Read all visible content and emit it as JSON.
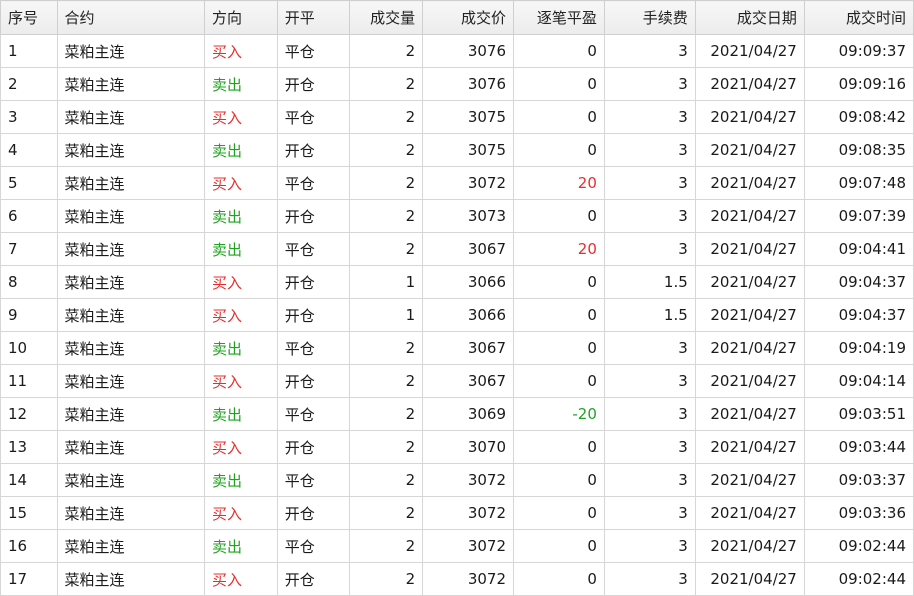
{
  "columns": [
    "序号",
    "合约",
    "方向",
    "开平",
    "成交量",
    "成交价",
    "逐笔平盈",
    "手续费",
    "成交日期",
    "成交时间"
  ],
  "colors": {
    "buy": "#ee2b2b",
    "sell": "#1fa41f"
  },
  "rows": [
    {
      "seq": "1",
      "contract": "菜粕主连",
      "direction": "买入",
      "offset": "平仓",
      "volume": "2",
      "price": "3076",
      "pnl": "0",
      "fee": "3",
      "date": "2021/04/27",
      "time": "09:09:37"
    },
    {
      "seq": "2",
      "contract": "菜粕主连",
      "direction": "卖出",
      "offset": "开仓",
      "volume": "2",
      "price": "3076",
      "pnl": "0",
      "fee": "3",
      "date": "2021/04/27",
      "time": "09:09:16"
    },
    {
      "seq": "3",
      "contract": "菜粕主连",
      "direction": "买入",
      "offset": "平仓",
      "volume": "2",
      "price": "3075",
      "pnl": "0",
      "fee": "3",
      "date": "2021/04/27",
      "time": "09:08:42"
    },
    {
      "seq": "4",
      "contract": "菜粕主连",
      "direction": "卖出",
      "offset": "开仓",
      "volume": "2",
      "price": "3075",
      "pnl": "0",
      "fee": "3",
      "date": "2021/04/27",
      "time": "09:08:35"
    },
    {
      "seq": "5",
      "contract": "菜粕主连",
      "direction": "买入",
      "offset": "平仓",
      "volume": "2",
      "price": "3072",
      "pnl": "20",
      "fee": "3",
      "date": "2021/04/27",
      "time": "09:07:48"
    },
    {
      "seq": "6",
      "contract": "菜粕主连",
      "direction": "卖出",
      "offset": "开仓",
      "volume": "2",
      "price": "3073",
      "pnl": "0",
      "fee": "3",
      "date": "2021/04/27",
      "time": "09:07:39"
    },
    {
      "seq": "7",
      "contract": "菜粕主连",
      "direction": "卖出",
      "offset": "平仓",
      "volume": "2",
      "price": "3067",
      "pnl": "20",
      "fee": "3",
      "date": "2021/04/27",
      "time": "09:04:41"
    },
    {
      "seq": "8",
      "contract": "菜粕主连",
      "direction": "买入",
      "offset": "开仓",
      "volume": "1",
      "price": "3066",
      "pnl": "0",
      "fee": "1.5",
      "date": "2021/04/27",
      "time": "09:04:37"
    },
    {
      "seq": "9",
      "contract": "菜粕主连",
      "direction": "买入",
      "offset": "开仓",
      "volume": "1",
      "price": "3066",
      "pnl": "0",
      "fee": "1.5",
      "date": "2021/04/27",
      "time": "09:04:37"
    },
    {
      "seq": "10",
      "contract": "菜粕主连",
      "direction": "卖出",
      "offset": "平仓",
      "volume": "2",
      "price": "3067",
      "pnl": "0",
      "fee": "3",
      "date": "2021/04/27",
      "time": "09:04:19"
    },
    {
      "seq": "11",
      "contract": "菜粕主连",
      "direction": "买入",
      "offset": "开仓",
      "volume": "2",
      "price": "3067",
      "pnl": "0",
      "fee": "3",
      "date": "2021/04/27",
      "time": "09:04:14"
    },
    {
      "seq": "12",
      "contract": "菜粕主连",
      "direction": "卖出",
      "offset": "平仓",
      "volume": "2",
      "price": "3069",
      "pnl": "-20",
      "fee": "3",
      "date": "2021/04/27",
      "time": "09:03:51"
    },
    {
      "seq": "13",
      "contract": "菜粕主连",
      "direction": "买入",
      "offset": "开仓",
      "volume": "2",
      "price": "3070",
      "pnl": "0",
      "fee": "3",
      "date": "2021/04/27",
      "time": "09:03:44"
    },
    {
      "seq": "14",
      "contract": "菜粕主连",
      "direction": "卖出",
      "offset": "平仓",
      "volume": "2",
      "price": "3072",
      "pnl": "0",
      "fee": "3",
      "date": "2021/04/27",
      "time": "09:03:37"
    },
    {
      "seq": "15",
      "contract": "菜粕主连",
      "direction": "买入",
      "offset": "开仓",
      "volume": "2",
      "price": "3072",
      "pnl": "0",
      "fee": "3",
      "date": "2021/04/27",
      "time": "09:03:36"
    },
    {
      "seq": "16",
      "contract": "菜粕主连",
      "direction": "卖出",
      "offset": "平仓",
      "volume": "2",
      "price": "3072",
      "pnl": "0",
      "fee": "3",
      "date": "2021/04/27",
      "time": "09:02:44"
    },
    {
      "seq": "17",
      "contract": "菜粕主连",
      "direction": "买入",
      "offset": "开仓",
      "volume": "2",
      "price": "3072",
      "pnl": "0",
      "fee": "3",
      "date": "2021/04/27",
      "time": "09:02:44"
    }
  ]
}
